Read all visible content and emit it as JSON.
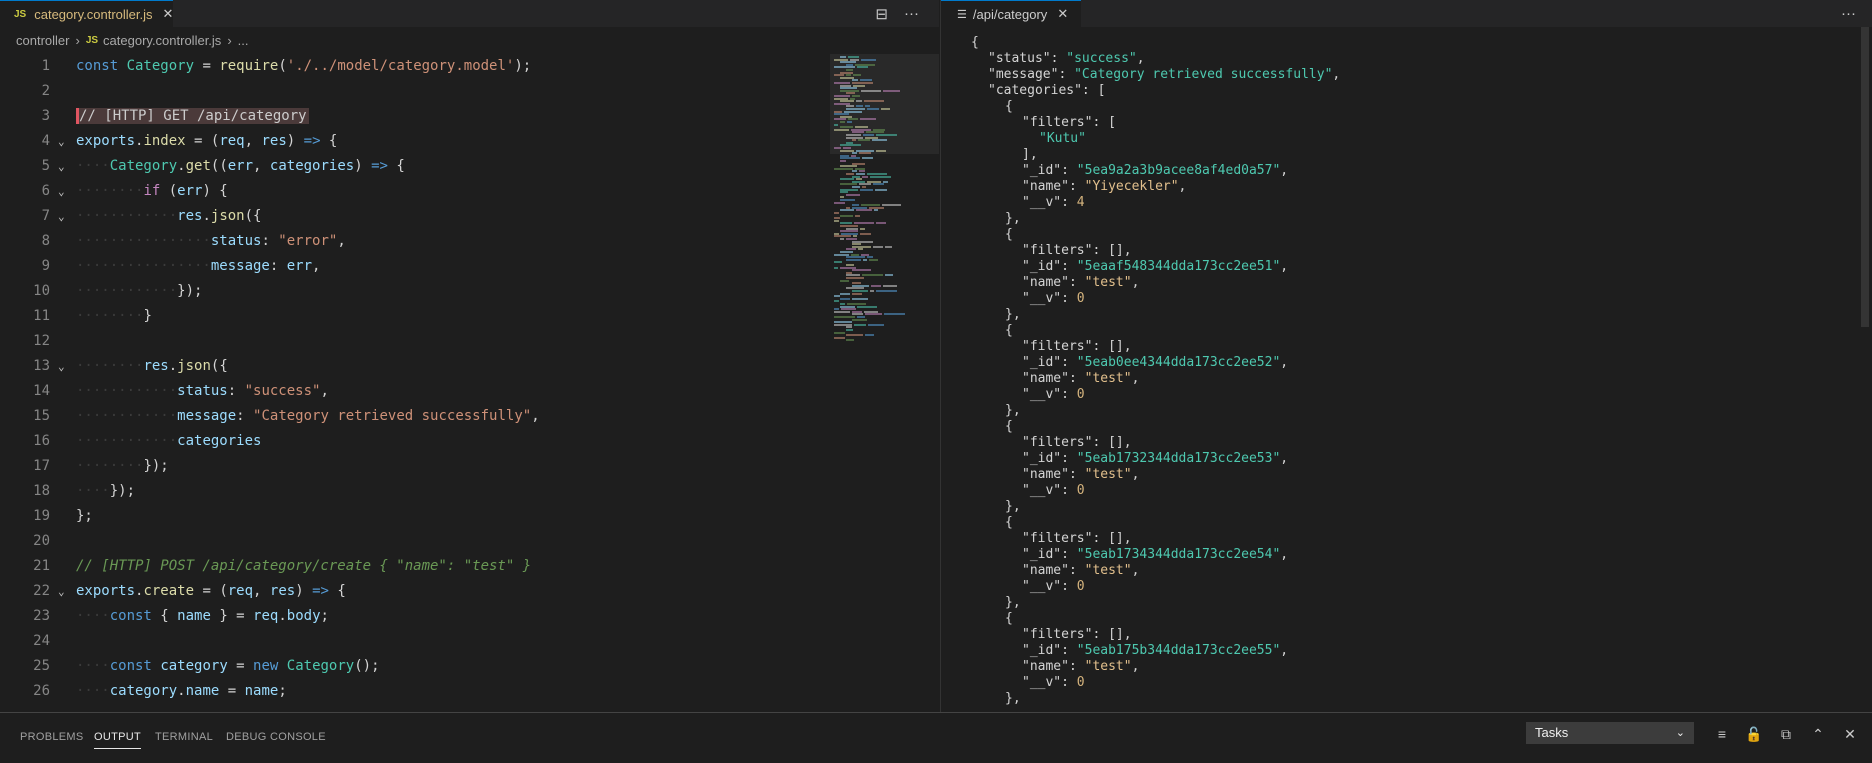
{
  "editor": {
    "tab": {
      "badge": "JS",
      "label": "category.controller.js",
      "close": "✕"
    },
    "breadcrumb": {
      "folder": "controller",
      "sep": "›",
      "badge": "JS",
      "file": "category.controller.js",
      "more": "..."
    },
    "actions": {
      "split": "⊟",
      "more": "···"
    }
  },
  "preview": {
    "tab": {
      "label": "/api/category",
      "close": "✕"
    },
    "actions": {
      "more": "···"
    }
  },
  "panel": {
    "tabs": [
      {
        "label": "PROBLEMS"
      },
      {
        "label": "OUTPUT"
      },
      {
        "label": "TERMINAL"
      },
      {
        "label": "DEBUG CONSOLE"
      }
    ],
    "active_tab": "OUTPUT",
    "task_select": {
      "value": "Tasks",
      "chev": "⌄"
    },
    "icons": {
      "clear": "≡",
      "lock": "🔓",
      "copy": "⧉",
      "maximize": "⌃",
      "close": "✕"
    }
  },
  "code_lines": [
    {
      "n": "1",
      "fold": "",
      "tokens": [
        [
          "tok-decl",
          "const "
        ],
        [
          "tok-type",
          "Category"
        ],
        [
          "tok-txt",
          " = "
        ],
        [
          "tok-fn",
          "require"
        ],
        [
          "tok-txt",
          "("
        ],
        [
          "tok-str",
          "'./../model/category.model'"
        ],
        [
          "tok-txt",
          ");"
        ]
      ]
    },
    {
      "n": "2",
      "fold": "",
      "tokens": []
    },
    {
      "n": "3",
      "fold": "",
      "tokens": [
        [
          "highlight-comment",
          "// [HTTP] GET /api/category"
        ]
      ]
    },
    {
      "n": "4",
      "fold": "⌄",
      "tokens": [
        [
          "tok-var",
          "exports"
        ],
        [
          "tok-txt",
          "."
        ],
        [
          "tok-fn",
          "index"
        ],
        [
          "tok-txt",
          " = ("
        ],
        [
          "tok-var",
          "req"
        ],
        [
          "tok-txt",
          ", "
        ],
        [
          "tok-var",
          "res"
        ],
        [
          "tok-txt",
          ") "
        ],
        [
          "tok-decl",
          "=>"
        ],
        [
          "tok-txt",
          " {"
        ]
      ]
    },
    {
      "n": "5",
      "fold": "⌄",
      "tokens": [
        [
          "ws",
          "····"
        ],
        [
          "tok-type",
          "Category"
        ],
        [
          "tok-txt",
          "."
        ],
        [
          "tok-fn",
          "get"
        ],
        [
          "tok-txt",
          "(("
        ],
        [
          "tok-var",
          "err"
        ],
        [
          "tok-txt",
          ", "
        ],
        [
          "tok-var",
          "categories"
        ],
        [
          "tok-txt",
          ") "
        ],
        [
          "tok-decl",
          "=>"
        ],
        [
          "tok-txt",
          " {"
        ]
      ]
    },
    {
      "n": "6",
      "fold": "⌄",
      "tokens": [
        [
          "ws",
          "········"
        ],
        [
          "tok-kw",
          "if"
        ],
        [
          "tok-txt",
          " ("
        ],
        [
          "tok-var",
          "err"
        ],
        [
          "tok-txt",
          ") {"
        ]
      ]
    },
    {
      "n": "7",
      "fold": "⌄",
      "tokens": [
        [
          "ws",
          "············"
        ],
        [
          "tok-var",
          "res"
        ],
        [
          "tok-txt",
          "."
        ],
        [
          "tok-fn",
          "json"
        ],
        [
          "tok-txt",
          "({"
        ]
      ]
    },
    {
      "n": "8",
      "fold": "",
      "tokens": [
        [
          "ws",
          "················"
        ],
        [
          "tok-var",
          "status"
        ],
        [
          "tok-txt",
          ": "
        ],
        [
          "tok-str",
          "\"error\""
        ],
        [
          "tok-txt",
          ","
        ]
      ]
    },
    {
      "n": "9",
      "fold": "",
      "tokens": [
        [
          "ws",
          "················"
        ],
        [
          "tok-var",
          "message"
        ],
        [
          "tok-txt",
          ": "
        ],
        [
          "tok-var",
          "err"
        ],
        [
          "tok-txt",
          ","
        ]
      ]
    },
    {
      "n": "10",
      "fold": "",
      "tokens": [
        [
          "ws",
          "············"
        ],
        [
          "tok-txt",
          "});"
        ]
      ]
    },
    {
      "n": "11",
      "fold": "",
      "tokens": [
        [
          "ws",
          "········"
        ],
        [
          "tok-txt",
          "}"
        ]
      ]
    },
    {
      "n": "12",
      "fold": "",
      "tokens": []
    },
    {
      "n": "13",
      "fold": "⌄",
      "tokens": [
        [
          "ws",
          "········"
        ],
        [
          "tok-var",
          "res"
        ],
        [
          "tok-txt",
          "."
        ],
        [
          "tok-fn",
          "json"
        ],
        [
          "tok-txt",
          "({"
        ]
      ]
    },
    {
      "n": "14",
      "fold": "",
      "tokens": [
        [
          "ws",
          "············"
        ],
        [
          "tok-var",
          "status"
        ],
        [
          "tok-txt",
          ": "
        ],
        [
          "tok-str",
          "\"success\""
        ],
        [
          "tok-txt",
          ","
        ]
      ]
    },
    {
      "n": "15",
      "fold": "",
      "tokens": [
        [
          "ws",
          "············"
        ],
        [
          "tok-var",
          "message"
        ],
        [
          "tok-txt",
          ": "
        ],
        [
          "tok-str",
          "\"Category retrieved successfully\""
        ],
        [
          "tok-txt",
          ","
        ]
      ]
    },
    {
      "n": "16",
      "fold": "",
      "tokens": [
        [
          "ws",
          "············"
        ],
        [
          "tok-var",
          "categories"
        ]
      ]
    },
    {
      "n": "17",
      "fold": "",
      "tokens": [
        [
          "ws",
          "········"
        ],
        [
          "tok-txt",
          "});"
        ]
      ]
    },
    {
      "n": "18",
      "fold": "",
      "tokens": [
        [
          "ws",
          "····"
        ],
        [
          "tok-txt",
          "});"
        ]
      ]
    },
    {
      "n": "19",
      "fold": "",
      "tokens": [
        [
          "tok-txt",
          "};"
        ]
      ]
    },
    {
      "n": "20",
      "fold": "",
      "tokens": []
    },
    {
      "n": "21",
      "fold": "",
      "tokens": [
        [
          "tok-com",
          "// [HTTP] POST /api/category/create { \"name\": \"test\" }"
        ]
      ]
    },
    {
      "n": "22",
      "fold": "⌄",
      "tokens": [
        [
          "tok-var",
          "exports"
        ],
        [
          "tok-txt",
          "."
        ],
        [
          "tok-fn",
          "create"
        ],
        [
          "tok-txt",
          " = ("
        ],
        [
          "tok-var",
          "req"
        ],
        [
          "tok-txt",
          ", "
        ],
        [
          "tok-var",
          "res"
        ],
        [
          "tok-txt",
          ") "
        ],
        [
          "tok-decl",
          "=>"
        ],
        [
          "tok-txt",
          " {"
        ]
      ]
    },
    {
      "n": "23",
      "fold": "",
      "tokens": [
        [
          "ws",
          "····"
        ],
        [
          "tok-decl",
          "const"
        ],
        [
          "tok-txt",
          " { "
        ],
        [
          "tok-var",
          "name"
        ],
        [
          "tok-txt",
          " } = "
        ],
        [
          "tok-var",
          "req"
        ],
        [
          "tok-txt",
          "."
        ],
        [
          "tok-var",
          "body"
        ],
        [
          "tok-txt",
          ";"
        ]
      ]
    },
    {
      "n": "24",
      "fold": "",
      "tokens": []
    },
    {
      "n": "25",
      "fold": "",
      "tokens": [
        [
          "ws",
          "····"
        ],
        [
          "tok-decl",
          "const"
        ],
        [
          "tok-txt",
          " "
        ],
        [
          "tok-var",
          "category"
        ],
        [
          "tok-txt",
          " = "
        ],
        [
          "tok-decl",
          "new"
        ],
        [
          "tok-txt",
          " "
        ],
        [
          "tok-type",
          "Category"
        ],
        [
          "tok-txt",
          "();"
        ]
      ]
    },
    {
      "n": "26",
      "fold": "",
      "tokens": [
        [
          "ws",
          "····"
        ],
        [
          "tok-var",
          "category"
        ],
        [
          "tok-txt",
          "."
        ],
        [
          "tok-var",
          "name"
        ],
        [
          "tok-txt",
          " = "
        ],
        [
          "tok-var",
          "name"
        ],
        [
          "tok-txt",
          ";"
        ]
      ]
    }
  ],
  "json_lines": [
    [
      [
        "j-punc",
        "{"
      ]
    ],
    [
      [
        "j-key",
        "\"status\""
      ],
      [
        "j-punc",
        ": "
      ],
      [
        "j-str",
        "\"success\""
      ],
      [
        "j-punc",
        ","
      ]
    ],
    [
      [
        "j-key",
        "\"message\""
      ],
      [
        "j-punc",
        ": "
      ],
      [
        "j-str",
        "\"Category retrieved successfully\""
      ],
      [
        "j-punc",
        ","
      ]
    ],
    [
      [
        "j-key",
        "\"categories\""
      ],
      [
        "j-punc",
        ": ["
      ]
    ],
    [
      [
        "j-punc",
        "{"
      ]
    ],
    [
      [
        "j-key",
        "\"filters\""
      ],
      [
        "j-punc",
        ": ["
      ]
    ],
    [
      [
        "j-str",
        "\"Kutu\""
      ]
    ],
    [
      [
        "j-punc",
        "],"
      ]
    ],
    [
      [
        "j-key",
        "\"_id\""
      ],
      [
        "j-punc",
        ": "
      ],
      [
        "j-str",
        "\"5ea9a2a3b9acee8af4ed0a57\""
      ],
      [
        "j-punc",
        ","
      ]
    ],
    [
      [
        "j-key",
        "\"name\""
      ],
      [
        "j-punc",
        ": "
      ],
      [
        "j-str",
        "\"Yiyecekler\""
      ],
      [
        "j-punc",
        ","
      ]
    ],
    [
      [
        "j-key",
        "\"__v\""
      ],
      [
        "j-punc",
        ": "
      ],
      [
        "j-num",
        "4"
      ]
    ],
    [
      [
        "j-punc",
        "},"
      ]
    ],
    [
      [
        "j-punc",
        "{"
      ]
    ],
    [
      [
        "j-key",
        "\"filters\""
      ],
      [
        "j-punc",
        ": [],"
      ]
    ],
    [
      [
        "j-key",
        "\"_id\""
      ],
      [
        "j-punc",
        ": "
      ],
      [
        "j-str",
        "\"5eaaf548344dda173cc2ee51\""
      ],
      [
        "j-punc",
        ","
      ]
    ],
    [
      [
        "j-key",
        "\"name\""
      ],
      [
        "j-punc",
        ": "
      ],
      [
        "j-str",
        "\"test\""
      ],
      [
        "j-punc",
        ","
      ]
    ],
    [
      [
        "j-key",
        "\"__v\""
      ],
      [
        "j-punc",
        ": "
      ],
      [
        "j-num",
        "0"
      ]
    ],
    [
      [
        "j-punc",
        "},"
      ]
    ],
    [
      [
        "j-punc",
        "{"
      ]
    ],
    [
      [
        "j-key",
        "\"filters\""
      ],
      [
        "j-punc",
        ": [],"
      ]
    ],
    [
      [
        "j-key",
        "\"_id\""
      ],
      [
        "j-punc",
        ": "
      ],
      [
        "j-str",
        "\"5eab0ee4344dda173cc2ee52\""
      ],
      [
        "j-punc",
        ","
      ]
    ],
    [
      [
        "j-key",
        "\"name\""
      ],
      [
        "j-punc",
        ": "
      ],
      [
        "j-str",
        "\"test\""
      ],
      [
        "j-punc",
        ","
      ]
    ],
    [
      [
        "j-key",
        "\"__v\""
      ],
      [
        "j-punc",
        ": "
      ],
      [
        "j-num",
        "0"
      ]
    ],
    [
      [
        "j-punc",
        "},"
      ]
    ],
    [
      [
        "j-punc",
        "{"
      ]
    ],
    [
      [
        "j-key",
        "\"filters\""
      ],
      [
        "j-punc",
        ": [],"
      ]
    ],
    [
      [
        "j-key",
        "\"_id\""
      ],
      [
        "j-punc",
        ": "
      ],
      [
        "j-str",
        "\"5eab1732344dda173cc2ee53\""
      ],
      [
        "j-punc",
        ","
      ]
    ],
    [
      [
        "j-key",
        "\"name\""
      ],
      [
        "j-punc",
        ": "
      ],
      [
        "j-str",
        "\"test\""
      ],
      [
        "j-punc",
        ","
      ]
    ],
    [
      [
        "j-key",
        "\"__v\""
      ],
      [
        "j-punc",
        ": "
      ],
      [
        "j-num",
        "0"
      ]
    ],
    [
      [
        "j-punc",
        "},"
      ]
    ],
    [
      [
        "j-punc",
        "{"
      ]
    ],
    [
      [
        "j-key",
        "\"filters\""
      ],
      [
        "j-punc",
        ": [],"
      ]
    ],
    [
      [
        "j-key",
        "\"_id\""
      ],
      [
        "j-punc",
        ": "
      ],
      [
        "j-str",
        "\"5eab1734344dda173cc2ee54\""
      ],
      [
        "j-punc",
        ","
      ]
    ],
    [
      [
        "j-key",
        "\"name\""
      ],
      [
        "j-punc",
        ": "
      ],
      [
        "j-str",
        "\"test\""
      ],
      [
        "j-punc",
        ","
      ]
    ],
    [
      [
        "j-key",
        "\"__v\""
      ],
      [
        "j-punc",
        ": "
      ],
      [
        "j-num",
        "0"
      ]
    ],
    [
      [
        "j-punc",
        "},"
      ]
    ],
    [
      [
        "j-punc",
        "{"
      ]
    ],
    [
      [
        "j-key",
        "\"filters\""
      ],
      [
        "j-punc",
        ": [],"
      ]
    ],
    [
      [
        "j-key",
        "\"_id\""
      ],
      [
        "j-punc",
        ": "
      ],
      [
        "j-str",
        "\"5eab175b344dda173cc2ee55\""
      ],
      [
        "j-punc",
        ","
      ]
    ],
    [
      [
        "j-key",
        "\"name\""
      ],
      [
        "j-punc",
        ": "
      ],
      [
        "j-str",
        "\"test\""
      ],
      [
        "j-punc",
        ","
      ]
    ],
    [
      [
        "j-key",
        "\"__v\""
      ],
      [
        "j-punc",
        ": "
      ],
      [
        "j-num",
        "0"
      ]
    ],
    [
      [
        "j-punc",
        "},"
      ]
    ]
  ]
}
